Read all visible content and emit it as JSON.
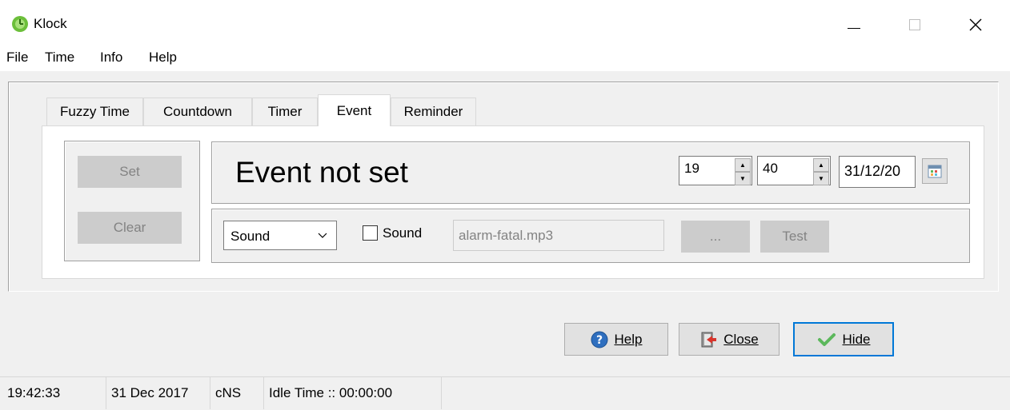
{
  "window": {
    "title": "Klock"
  },
  "menu": [
    "File",
    "Time",
    "Info",
    "Help"
  ],
  "tabs": [
    "Fuzzy Time",
    "Countdown",
    "Timer",
    "Event",
    "Reminder"
  ],
  "active_tab": "Event",
  "event": {
    "set_label": "Set",
    "clear_label": "Clear",
    "status_text": "Event not set",
    "hour": "19",
    "minute": "40",
    "date": "31/12/20",
    "sound_select": "Sound",
    "sound_checkbox_label": "Sound",
    "sound_file": "alarm-fatal.mp3",
    "browse_label": "...",
    "test_label": "Test"
  },
  "buttons": {
    "help_label": "Help",
    "close_label": "Close",
    "hide_label": "Hide"
  },
  "status": {
    "time": "19:42:33",
    "date": "31 Dec 2017",
    "mode": "cNS",
    "idle": "Idle Time :: 00:00:00"
  },
  "colors": {
    "focus_border": "#0078d7",
    "disabled_button": "#cccccc",
    "hide_check": "#5cb85c"
  }
}
